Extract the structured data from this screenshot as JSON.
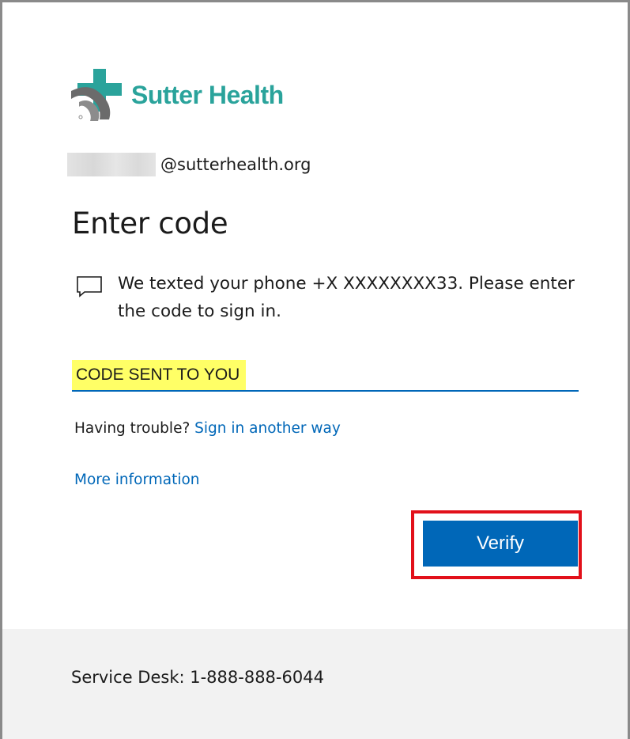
{
  "brand": {
    "name": "Sutter Health",
    "logo_icon": "sutter-health-cross-logo",
    "accent_color": "#2aa39b"
  },
  "identity": {
    "domain": "@sutterhealth.org"
  },
  "page": {
    "title": "Enter code",
    "message_icon": "chat-bubble-icon",
    "message": "We texted your phone +X XXXXXXXX33. Please enter the code to sign in."
  },
  "code_input": {
    "value": "CODE SENT TO YOU"
  },
  "help": {
    "trouble_text": "Having trouble?",
    "sign_in_another_way": "Sign in another way",
    "more_information": "More information"
  },
  "actions": {
    "verify_label": "Verify",
    "primary_color": "#0067b8",
    "highlight_color": "#e2101a"
  },
  "footer": {
    "service_desk": "Service Desk: 1-888-888-6044"
  }
}
